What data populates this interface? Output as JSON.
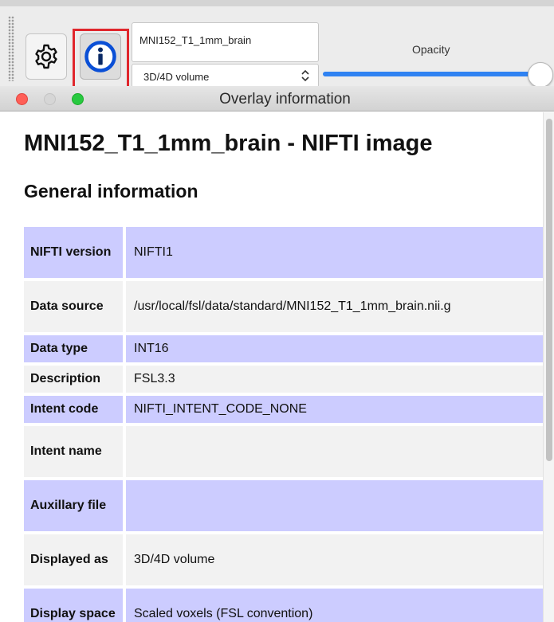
{
  "toolbar": {
    "overlay_name": "MNI152_T1_1mm_brain",
    "overlay_type": "3D/4D volume",
    "opacity_label": "Opacity",
    "opacity_value": 1.0,
    "highlight_color": "#e0262c",
    "gear_icon": "gear-icon",
    "info_icon": "info-icon"
  },
  "window": {
    "title": "Overlay information"
  },
  "content": {
    "page_title": "MNI152_T1_1mm_brain - NIFTI image",
    "section_title": "General information",
    "rows": [
      {
        "key": "NIFTI version",
        "value": "NIFTI1"
      },
      {
        "key": "Data source",
        "value": "/usr/local/fsl/data/standard/MNI152_T1_1mm_brain.nii.g"
      },
      {
        "key": "Data type",
        "value": "INT16"
      },
      {
        "key": "Description",
        "value": "FSL3.3"
      },
      {
        "key": "Intent code",
        "value": "NIFTI_INTENT_CODE_NONE"
      },
      {
        "key": "Intent name",
        "value": ""
      },
      {
        "key": "Auxillary file",
        "value": ""
      },
      {
        "key": "Displayed as",
        "value": "3D/4D volume"
      },
      {
        "key": "Display space",
        "value": "Scaled voxels (FSL convention)"
      }
    ]
  },
  "colors": {
    "row_odd": "#ccccff",
    "row_even": "#f2f2f2",
    "accent": "#2f82f2"
  }
}
